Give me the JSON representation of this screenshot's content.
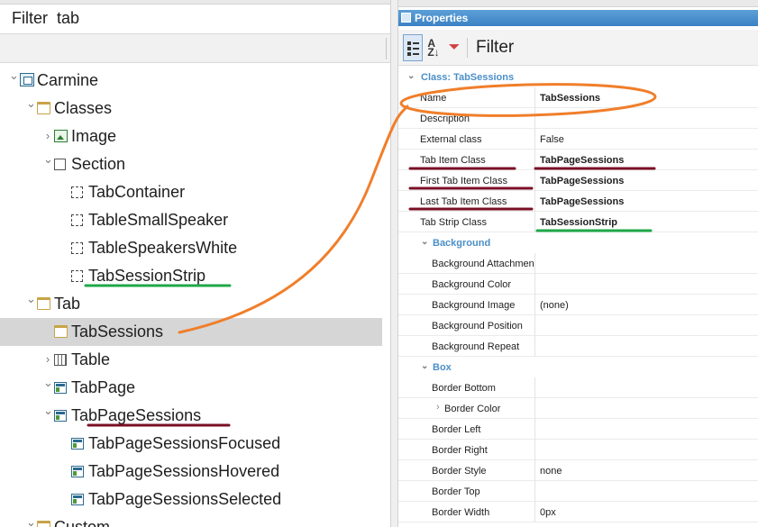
{
  "left_pane": {
    "filter_label": "Filter",
    "filter_value": "tab",
    "tree": [
      {
        "label": "Carmine",
        "icon": "project-icon",
        "chevron": "expanded"
      },
      {
        "label": "Classes",
        "icon": "folder-icon",
        "chevron": "expanded"
      },
      {
        "label": "Image",
        "icon": "image-icon",
        "chevron": "collapsed"
      },
      {
        "label": "Section",
        "icon": "section-icon",
        "chevron": "expanded"
      },
      {
        "label": "TabContainer",
        "icon": "section-dashed-icon",
        "chevron": "none"
      },
      {
        "label": "TableSmallSpeaker",
        "icon": "section-dashed-icon",
        "chevron": "none"
      },
      {
        "label": "TableSpeakersWhite",
        "icon": "section-dashed-icon",
        "chevron": "none"
      },
      {
        "label": "TabSessionStrip",
        "icon": "section-dashed-icon",
        "chevron": "none"
      },
      {
        "label": "Tab",
        "icon": "folder-icon",
        "chevron": "expanded"
      },
      {
        "label": "TabSessions",
        "icon": "folder-icon",
        "chevron": "none",
        "selected": true
      },
      {
        "label": "Table",
        "icon": "table-icon",
        "chevron": "collapsed"
      },
      {
        "label": "TabPage",
        "icon": "tabpage-icon",
        "chevron": "expanded"
      },
      {
        "label": "TabPageSessions",
        "icon": "tabpage-icon",
        "chevron": "expanded"
      },
      {
        "label": "TabPageSessionsFocused",
        "icon": "tabpage-icon",
        "chevron": "none"
      },
      {
        "label": "TabPageSessionsHovered",
        "icon": "tabpage-icon",
        "chevron": "none"
      },
      {
        "label": "TabPageSessionsSelected",
        "icon": "tabpage-icon",
        "chevron": "none"
      },
      {
        "label": "Custom",
        "icon": "folder-icon",
        "chevron": "expanded"
      }
    ]
  },
  "properties": {
    "title": "Properties",
    "toolbar": {
      "categorized_icon": "categorized-icon",
      "sort_icon": "sort-az-icon",
      "filter_icon": "funnel-icon",
      "filter_label": "Filter"
    },
    "groups": [
      {
        "title": "Class: TabSessions",
        "rows": [
          {
            "name": "Name",
            "value": "TabSessions",
            "bold": true
          },
          {
            "name": "Description",
            "value": ""
          },
          {
            "name": "External class",
            "value": "False"
          },
          {
            "name": "Tab Item Class",
            "value": "TabPageSessions",
            "bold": true
          },
          {
            "name": "First Tab Item Class",
            "value": "TabPageSessions",
            "bold": true
          },
          {
            "name": "Last Tab Item Class",
            "value": "TabPageSessions",
            "bold": true
          },
          {
            "name": "Tab Strip Class",
            "value": "TabSessionStrip",
            "bold": true
          }
        ]
      },
      {
        "title": "Background",
        "rows": [
          {
            "name": "Background Attachment",
            "value": ""
          },
          {
            "name": "Background Color",
            "value": ""
          },
          {
            "name": "Background Image",
            "value": "(none)"
          },
          {
            "name": "Background Position",
            "value": ""
          },
          {
            "name": "Background Repeat",
            "value": ""
          }
        ]
      },
      {
        "title": "Box",
        "rows": [
          {
            "name": "Border Bottom",
            "value": ""
          },
          {
            "name": "Border Color",
            "value": "",
            "expandable": true
          },
          {
            "name": "Border Left",
            "value": ""
          },
          {
            "name": "Border Right",
            "value": ""
          },
          {
            "name": "Border Style",
            "value": "none"
          },
          {
            "name": "Border Top",
            "value": ""
          },
          {
            "name": "Border Width",
            "value": "0px"
          }
        ]
      }
    ]
  },
  "annotations": {
    "ellipse_color": "#f07e2a",
    "underline_green": "#1fa84a",
    "underline_maroon": "#7a0f24"
  }
}
